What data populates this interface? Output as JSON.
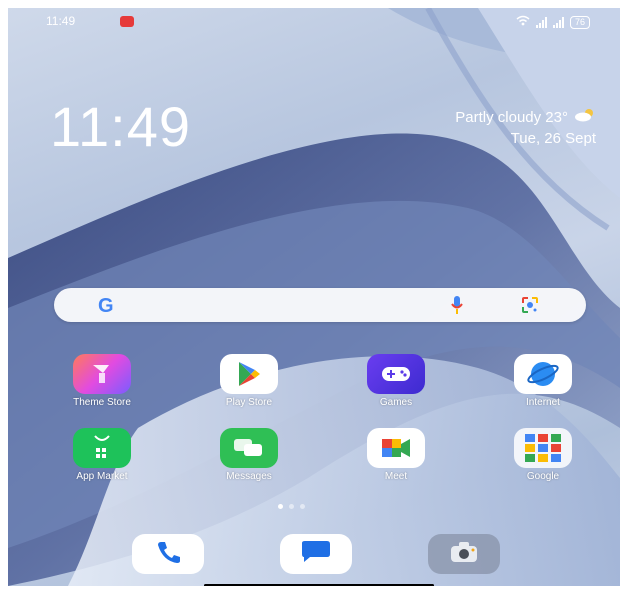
{
  "status_bar": {
    "time": "11:49",
    "battery": "76"
  },
  "clock": {
    "time": "11:49"
  },
  "weather": {
    "text": "Partly cloudy 23°",
    "date": "Tue, 26 Sept"
  },
  "apps": [
    {
      "label": "Theme Store",
      "icon": "theme-store-icon"
    },
    {
      "label": "Play Store",
      "icon": "play-store-icon"
    },
    {
      "label": "Games",
      "icon": "games-icon"
    },
    {
      "label": "Internet",
      "icon": "internet-icon"
    },
    {
      "label": "App Market",
      "icon": "app-market-icon"
    },
    {
      "label": "Messages",
      "icon": "messages-icon"
    },
    {
      "label": "Meet",
      "icon": "meet-icon"
    },
    {
      "label": "Google",
      "icon": "google-folder-icon"
    }
  ],
  "dock": [
    {
      "icon": "phone-icon"
    },
    {
      "icon": "chat-icon"
    },
    {
      "icon": "camera-icon"
    }
  ],
  "page_indicator": {
    "pages": 3,
    "current": 1
  },
  "colors": {
    "google_blue": "#4285F4",
    "google_red": "#EA4335",
    "google_yellow": "#FBBC05",
    "google_green": "#34A853"
  }
}
